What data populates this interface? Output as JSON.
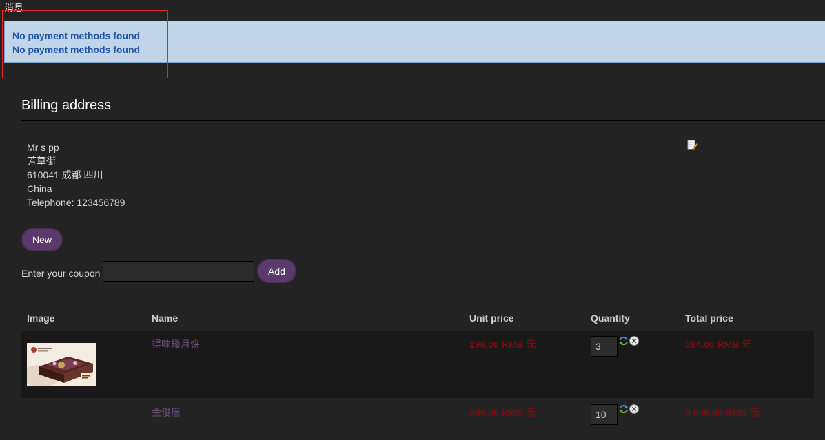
{
  "messages": {
    "title": "消息",
    "lines": [
      "No payment methods found",
      "No payment methods found"
    ]
  },
  "billing": {
    "title": "Billing address",
    "address_lines": [
      "Mr s pp",
      "芳草街",
      "610041 成都 四川",
      "China",
      "Telephone: 123456789"
    ],
    "new_label": "New",
    "edit_icon": "edit-pencil-icon"
  },
  "coupon": {
    "label": "Enter your coupon",
    "value": "",
    "add_label": "Add"
  },
  "cart": {
    "headers": [
      "Image",
      "Name",
      "Unit price",
      "Quantity",
      "Total price"
    ],
    "rows": [
      {
        "name": "得味楼月饼",
        "unit_price": "198.00 RMB 元",
        "quantity": "3",
        "total_price": "594.00 RMB 元",
        "has_image": true
      },
      {
        "name": "金俊眉",
        "unit_price": "880.00 RMB 元",
        "quantity": "10",
        "total_price": "8 800.00 RMB 元",
        "has_image": false
      }
    ]
  },
  "colors": {
    "background": "#232323",
    "message_bg": "#c1d5ea",
    "message_text": "#1f55a7",
    "highlight": "#e1262c",
    "button_bg": "#5a3a6a",
    "product_name": "#6b4f7a",
    "price": "#7a0d14"
  }
}
